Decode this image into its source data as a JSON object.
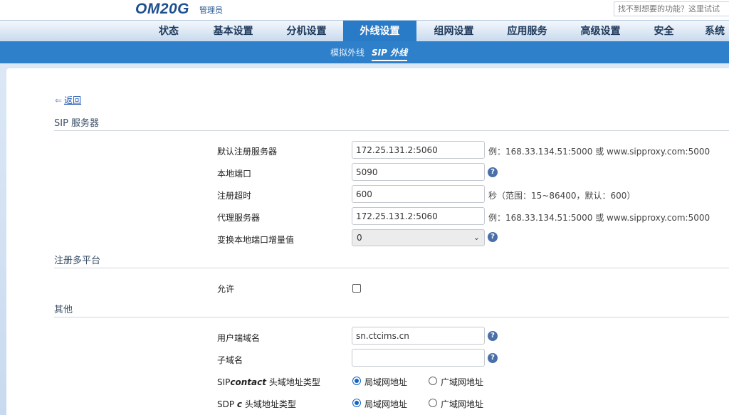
{
  "header": {
    "logo": "OM20G",
    "role": "管理员",
    "search_placeholder": "找不到想要的功能？这里试试"
  },
  "nav": {
    "items": [
      "状态",
      "基本设置",
      "分机设置",
      "外线设置",
      "组网设置",
      "应用服务",
      "高级设置",
      "安全",
      "系统"
    ],
    "active": "外线设置"
  },
  "subnav": {
    "items": [
      "模拟外线",
      "SIP 外线"
    ],
    "active": "SIP 外线"
  },
  "back_label": "返回",
  "sections": {
    "sip_server": {
      "title": "SIP 服务器",
      "default_reg_server": {
        "label": "默认注册服务器",
        "value": "172.25.131.2:5060",
        "hint": "例：168.33.134.51:5000 或 www.sipproxy.com:5000"
      },
      "local_port": {
        "label": "本地端口",
        "value": "5090"
      },
      "reg_timeout": {
        "label": "注册超时",
        "value": "600",
        "hint": "秒（范围：15~86400，默认：600）"
      },
      "proxy_server": {
        "label": "代理服务器",
        "value": "172.25.131.2:5060",
        "hint": "例：168.33.134.51:5000 或 www.sipproxy.com:5000"
      },
      "port_increment": {
        "label": "变换本地端口增量值",
        "value": "0"
      }
    },
    "multi_platform": {
      "title": "注册多平台",
      "allow": {
        "label": "允许",
        "checked": false
      }
    },
    "other": {
      "title": "其他",
      "user_domain": {
        "label": "用户端域名",
        "value": "sn.ctcims.cn"
      },
      "sub_domain": {
        "label": "子域名",
        "value": ""
      },
      "contact_type": {
        "label_prefix": "SIP",
        "label_em": "contact",
        "label_suffix": " 头域地址类型",
        "options": [
          "局域网地址",
          "广域网地址"
        ],
        "selected": "局域网地址"
      },
      "sdp_type": {
        "label_prefix": "SDP ",
        "label_em": "c",
        "label_suffix": " 头域地址类型",
        "options": [
          "局域网地址",
          "广域网地址"
        ],
        "selected": "局域网地址"
      }
    }
  },
  "help_glyph": "?",
  "back_arrow_glyph": "⇐",
  "select_chevron_glyph": "⌄",
  "colors": {
    "accent": "#2d80c9",
    "nav_active": "#2a7bc7",
    "logo": "#1d4f8e",
    "link": "#1d57b6"
  }
}
